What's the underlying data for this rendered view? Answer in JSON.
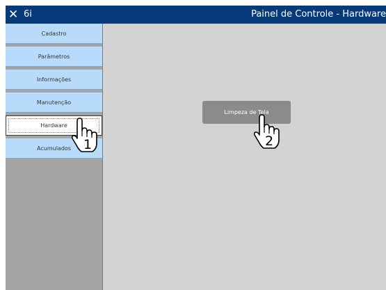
{
  "titlebar": {
    "close_glyph": "✕",
    "app_name": "6i",
    "window_title": "Painel de Controle - Hardware"
  },
  "sidebar": {
    "items": [
      {
        "label": "Cadastro",
        "selected": false
      },
      {
        "label": "Parâmetros",
        "selected": false
      },
      {
        "label": "Informações",
        "selected": false
      },
      {
        "label": "Manutenção",
        "selected": false
      },
      {
        "label": "Hardware",
        "selected": true
      },
      {
        "label": "Acumulados",
        "selected": false
      }
    ]
  },
  "main": {
    "clean_screen_label": "Limpeza de Tela"
  },
  "annotations": {
    "step1": "1",
    "step2": "2"
  },
  "colors": {
    "titlebar": "#073a7a",
    "menu_button": "#b9dbfb",
    "content_bg": "#d3d3d3",
    "sidebar_bg": "#a5a4a5"
  }
}
